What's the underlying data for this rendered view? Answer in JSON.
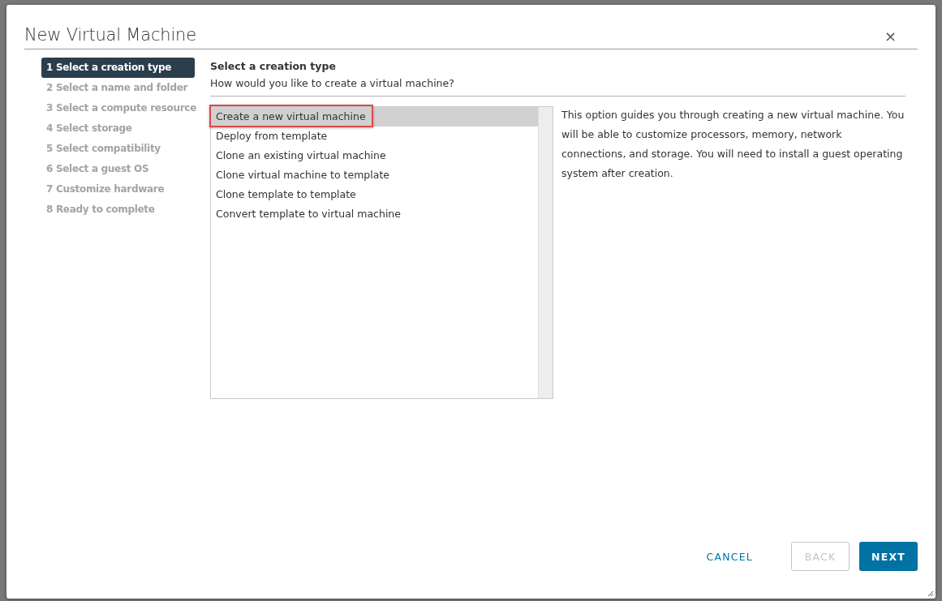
{
  "dialog": {
    "title": "New Virtual Machine",
    "close": "×"
  },
  "steps": [
    {
      "label": "1 Select a creation type",
      "selected": true
    },
    {
      "label": "2 Select a name and folder",
      "selected": false
    },
    {
      "label": "3 Select a compute resource",
      "selected": false
    },
    {
      "label": "4 Select storage",
      "selected": false
    },
    {
      "label": "5 Select compatibility",
      "selected": false
    },
    {
      "label": "6 Select a guest OS",
      "selected": false
    },
    {
      "label": "7 Customize hardware",
      "selected": false
    },
    {
      "label": "8 Ready to complete",
      "selected": false
    }
  ],
  "page": {
    "heading": "Select a creation type",
    "subtitle": "How would you like to create a virtual machine?"
  },
  "options": [
    {
      "label": "Create a new virtual machine",
      "selected": true,
      "highlighted": true
    },
    {
      "label": "Deploy from template",
      "selected": false,
      "highlighted": false
    },
    {
      "label": "Clone an existing virtual machine",
      "selected": false,
      "highlighted": false
    },
    {
      "label": "Clone virtual machine to template",
      "selected": false,
      "highlighted": false
    },
    {
      "label": "Clone template to template",
      "selected": false,
      "highlighted": false
    },
    {
      "label": "Convert template to virtual machine",
      "selected": false,
      "highlighted": false
    }
  ],
  "description": "This option guides you through creating a new virtual machine. You will be able to customize processors, memory, network connections, and storage. You will need to install a guest operating system after creation.",
  "buttons": [
    {
      "label": "CANCEL",
      "kind": "link",
      "disabled": false
    },
    {
      "label": "BACK",
      "kind": "outline",
      "disabled": true
    },
    {
      "label": "NEXT",
      "kind": "primary",
      "disabled": false
    }
  ]
}
